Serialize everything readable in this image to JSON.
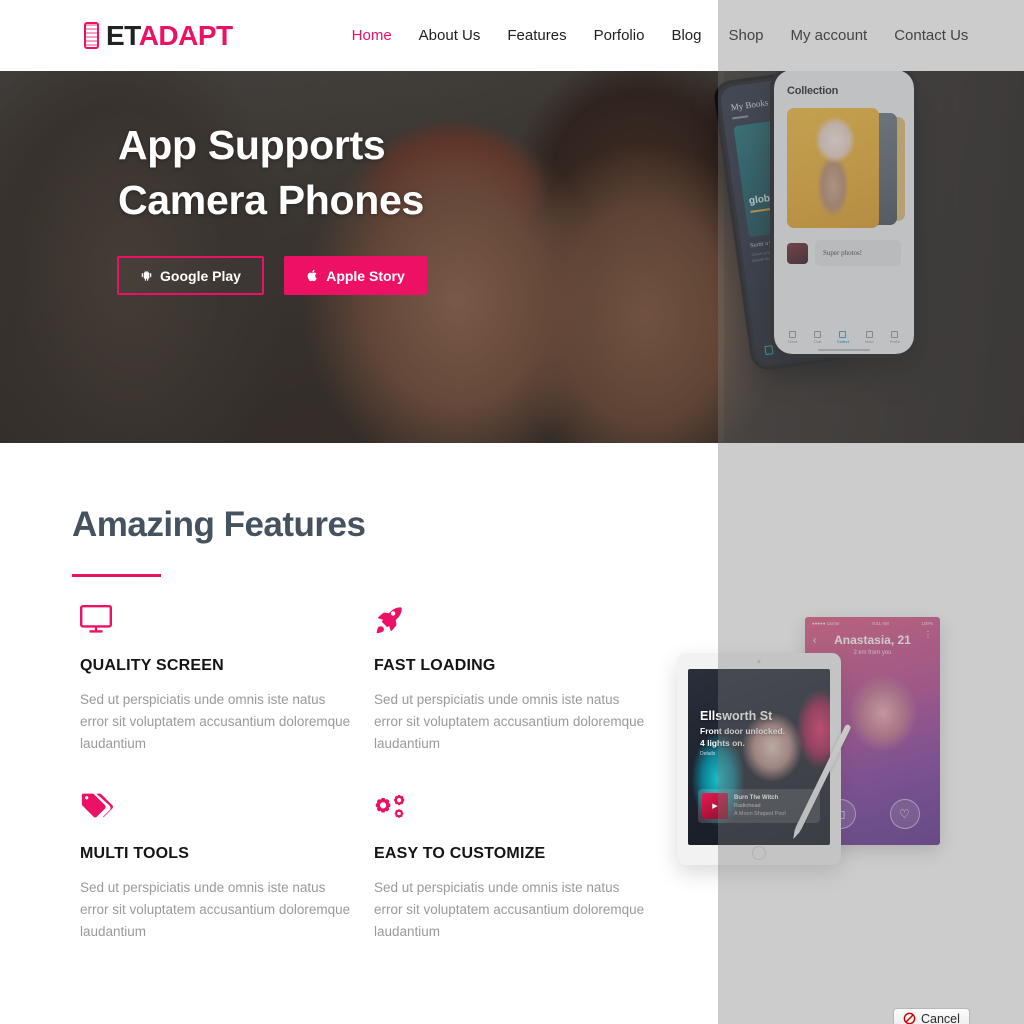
{
  "header": {
    "logo": {
      "icon": "phone-logo-icon",
      "text_primary": "ET",
      "text_accent": "ADAPT"
    },
    "nav": [
      {
        "label": "Home",
        "active": true
      },
      {
        "label": "About Us",
        "active": false
      },
      {
        "label": "Features",
        "active": false
      },
      {
        "label": "Porfolio",
        "active": false
      },
      {
        "label": "Blog",
        "active": false
      },
      {
        "label": "Shop",
        "active": false
      },
      {
        "label": "My account",
        "active": false
      },
      {
        "label": "Contact Us",
        "active": false
      }
    ]
  },
  "hero": {
    "title": "App Supports\nCamera Phones",
    "buttons": [
      {
        "label": "Google Play",
        "icon": "android-icon",
        "style": "outline"
      },
      {
        "label": "Apple Story",
        "icon": "apple-icon",
        "style": "solid"
      }
    ],
    "phone_front": {
      "title": "Collection",
      "comment": "Super photos!",
      "nav": [
        {
          "label": "Home",
          "active": false
        },
        {
          "label": "Chat",
          "active": false
        },
        {
          "label": "Collect",
          "active": true
        },
        {
          "label": "News",
          "active": false
        },
        {
          "label": "Profile",
          "active": false
        }
      ]
    },
    "phone_back": {
      "title": "My Books",
      "card_title": "global growth",
      "sub_title": "Sortir a Camer",
      "sub_text": "Omnis phasellus libero lorem tincidunt a blandit dictum."
    }
  },
  "features": {
    "section_title": "Amazing Features",
    "items": [
      {
        "icon": "monitor-icon",
        "title": "QUALITY SCREEN",
        "desc": "Sed ut perspiciatis unde omnis iste natus error sit voluptatem accusantium doloremque laudantium"
      },
      {
        "icon": "rocket-icon",
        "title": "FAST LOADING",
        "desc": "Sed ut perspiciatis unde omnis iste natus error sit voluptatem accusantium doloremque laudantium"
      },
      {
        "icon": "tags-icon",
        "title": "MULTI TOOLS",
        "desc": "Sed ut perspiciatis unde omnis iste natus error sit voluptatem accusantium doloremque laudantium"
      },
      {
        "icon": "gears-icon",
        "title": "EASY TO CUSTOMIZE",
        "desc": "Sed ut perspiciatis unde omnis iste natus error sit voluptatem accusantium doloremque laudantium"
      }
    ],
    "devices": {
      "tablet": {
        "street_title": "Ellsworth St",
        "status_line1": "Front door unlocked.",
        "status_line2": "4 lights on.",
        "details_label": "Details",
        "track_title": "Burn The Witch",
        "track_artist": "Radiohead",
        "track_album": "A Moon Shaped Pool"
      },
      "phone": {
        "status_left": "●●●●●  carrier",
        "status_center": "9:41 AM",
        "status_right": "100%",
        "name": "Anastasia, 21",
        "subtitle": "2 km from you",
        "action_left": "chat",
        "action_right": "like"
      }
    }
  },
  "footer_controls": {
    "cancel_label": "Cancel",
    "cancel_icon": "no-entry-icon"
  },
  "colors": {
    "accent_pink": "#ed1165",
    "heading_slate": "#45525f",
    "body_gray": "#9a9a9a",
    "nav_dark": "#222222",
    "overlay_gray": "rgba(120,120,120,0.38)"
  }
}
